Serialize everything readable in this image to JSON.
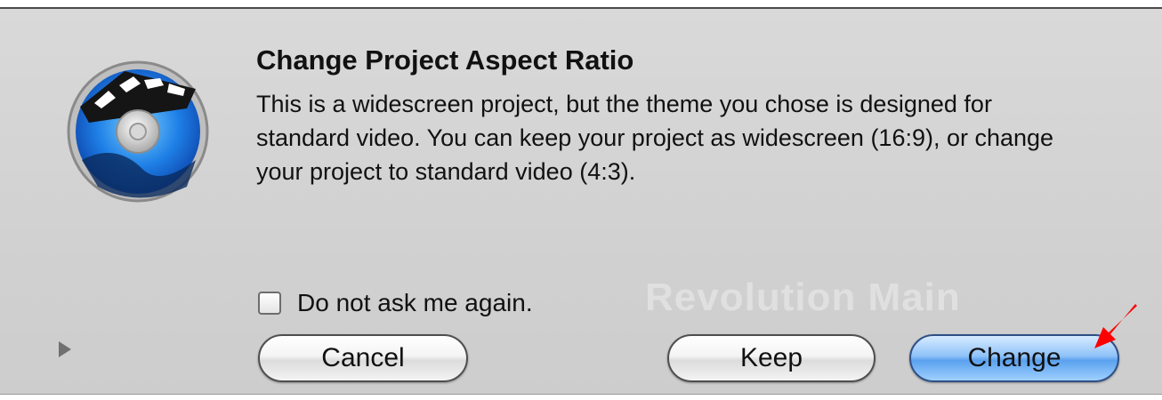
{
  "dialog": {
    "title": "Change Project Aspect Ratio",
    "message": "This is a widescreen project, but the theme you chose is designed for standard video. You can keep your project as widescreen (16:9), or change your project to standard video (4:3).",
    "background_text": "Revolution Main",
    "app_icon": "idvd-disc-icon",
    "checkbox": {
      "label": "Do not ask me again.",
      "checked": false
    },
    "disclosure_icon": "disclosure-triangle-icon",
    "buttons": {
      "cancel": "Cancel",
      "keep": "Keep",
      "change": "Change"
    },
    "default_button": "Change",
    "annotation_icon": "red-arrow-icon"
  },
  "colors": {
    "dialog_bg": "#d3d3d3",
    "default_button": "#5aa1ee",
    "annotation_arrow": "#ff0000"
  }
}
